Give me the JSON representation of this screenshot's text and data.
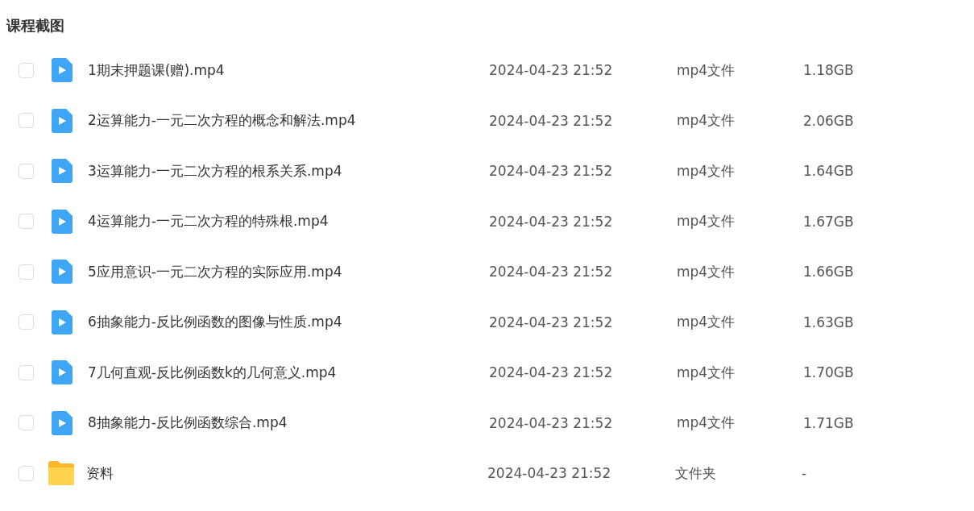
{
  "title": "课程截图",
  "files": [
    {
      "kind": "video",
      "checked": false,
      "name": "1期末押题课(赠).mp4",
      "date": "2024-04-23 21:52",
      "type": "mp4文件",
      "size": "1.18GB"
    },
    {
      "kind": "video",
      "checked": false,
      "name": "2运算能力-一元二次方程的概念和解法.mp4",
      "date": "2024-04-23 21:52",
      "type": "mp4文件",
      "size": "2.06GB"
    },
    {
      "kind": "video",
      "checked": false,
      "name": "3运算能力-一元二次方程的根系关系.mp4",
      "date": "2024-04-23 21:52",
      "type": "mp4文件",
      "size": "1.64GB"
    },
    {
      "kind": "video",
      "checked": false,
      "name": "4运算能力-一元二次方程的特殊根.mp4",
      "date": "2024-04-23 21:52",
      "type": "mp4文件",
      "size": "1.67GB"
    },
    {
      "kind": "video",
      "checked": false,
      "name": "5应用意识-一元二次方程的实际应用.mp4",
      "date": "2024-04-23 21:52",
      "type": "mp4文件",
      "size": "1.66GB"
    },
    {
      "kind": "video",
      "checked": false,
      "name": "6抽象能力-反比例函数的图像与性质.mp4",
      "date": "2024-04-23 21:52",
      "type": "mp4文件",
      "size": "1.63GB"
    },
    {
      "kind": "video",
      "checked": false,
      "name": "7几何直观-反比例函数k的几何意义.mp4",
      "date": "2024-04-23 21:52",
      "type": "mp4文件",
      "size": "1.70GB"
    },
    {
      "kind": "video",
      "checked": false,
      "name": "8抽象能力-反比例函数综合.mp4",
      "date": "2024-04-23 21:52",
      "type": "mp4文件",
      "size": "1.71GB"
    },
    {
      "kind": "folder",
      "checked": false,
      "name": "资料",
      "date": "2024-04-23 21:52",
      "type": "文件夹",
      "size": "-"
    }
  ]
}
